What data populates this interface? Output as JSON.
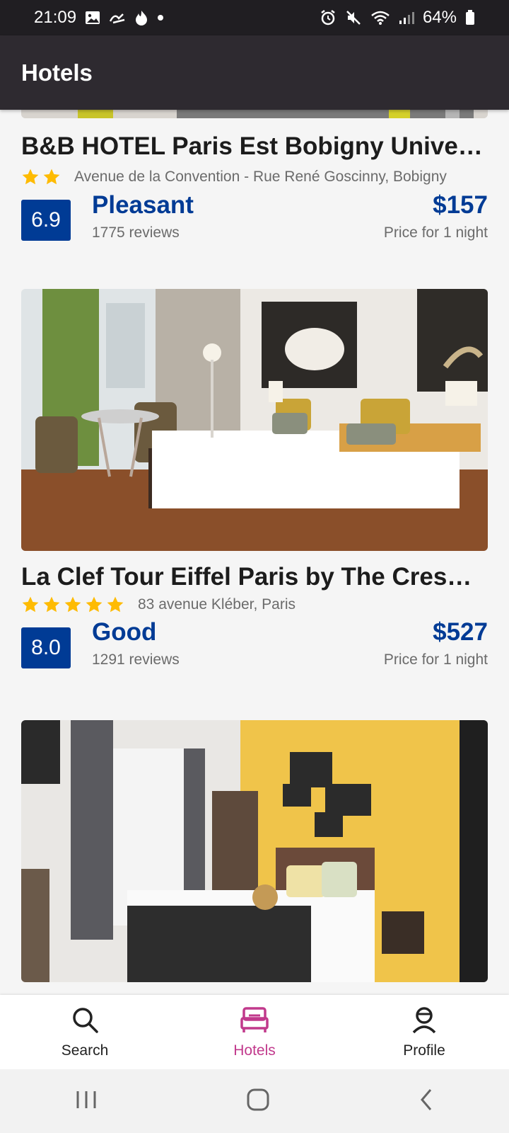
{
  "status_bar": {
    "time": "21:09",
    "battery": "64%",
    "left_icons": [
      "image-icon",
      "nearby-share-icon",
      "flame-icon",
      "dot-icon"
    ],
    "right_icons": [
      "alarm-icon",
      "mute-icon",
      "wifi-icon",
      "signal-icon",
      "battery-icon"
    ]
  },
  "app_bar": {
    "title": "Hotels"
  },
  "hotels": [
    {
      "name": "B&B HOTEL Paris Est Bobigny Unive…",
      "stars": 2,
      "address": "Avenue de la Convention - Rue René Goscinny, Bobigny",
      "score": "6.9",
      "rating": "Pleasant",
      "reviews": "1775 reviews",
      "price": "$157",
      "price_note": "Price for 1 night"
    },
    {
      "name": "La Clef Tour Eiffel Paris by The Cres…",
      "stars": 5,
      "address": "83 avenue Kléber, Paris",
      "score": "8.0",
      "rating": "Good",
      "reviews": "1291 reviews",
      "price": "$527",
      "price_note": "Price for 1 night"
    }
  ],
  "bottom_nav": {
    "items": [
      {
        "label": "Search",
        "icon": "search-icon",
        "active": false
      },
      {
        "label": "Hotels",
        "icon": "bed-icon",
        "active": true
      },
      {
        "label": "Profile",
        "icon": "profile-icon",
        "active": false
      }
    ],
    "active_color": "#c1398c"
  },
  "colors": {
    "score_badge": "#003b95",
    "star": "#febb02",
    "app_bar": "#2e2a30"
  }
}
